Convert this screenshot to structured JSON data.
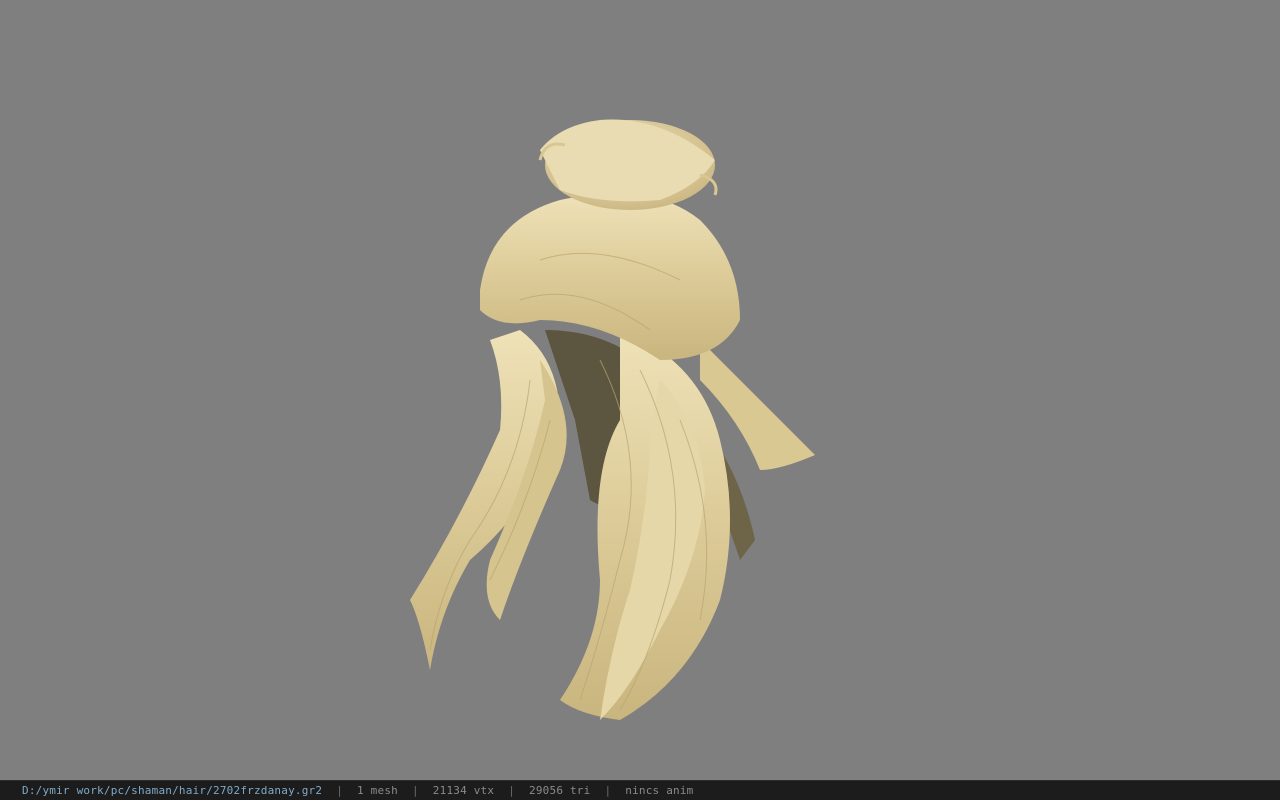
{
  "viewer": {
    "background_color": "#7f7f7f",
    "model_name": "hair-model",
    "hair_color": "#e2d3a4"
  },
  "status_bar": {
    "file_path": "D:/ymir work/pc/shaman/hair/2702frzdanay.gr2",
    "separator": "|",
    "mesh_count": "1 mesh",
    "vertex_count": "21134 vtx",
    "triangle_count": "29056 tri",
    "animation": "nincs anim"
  }
}
